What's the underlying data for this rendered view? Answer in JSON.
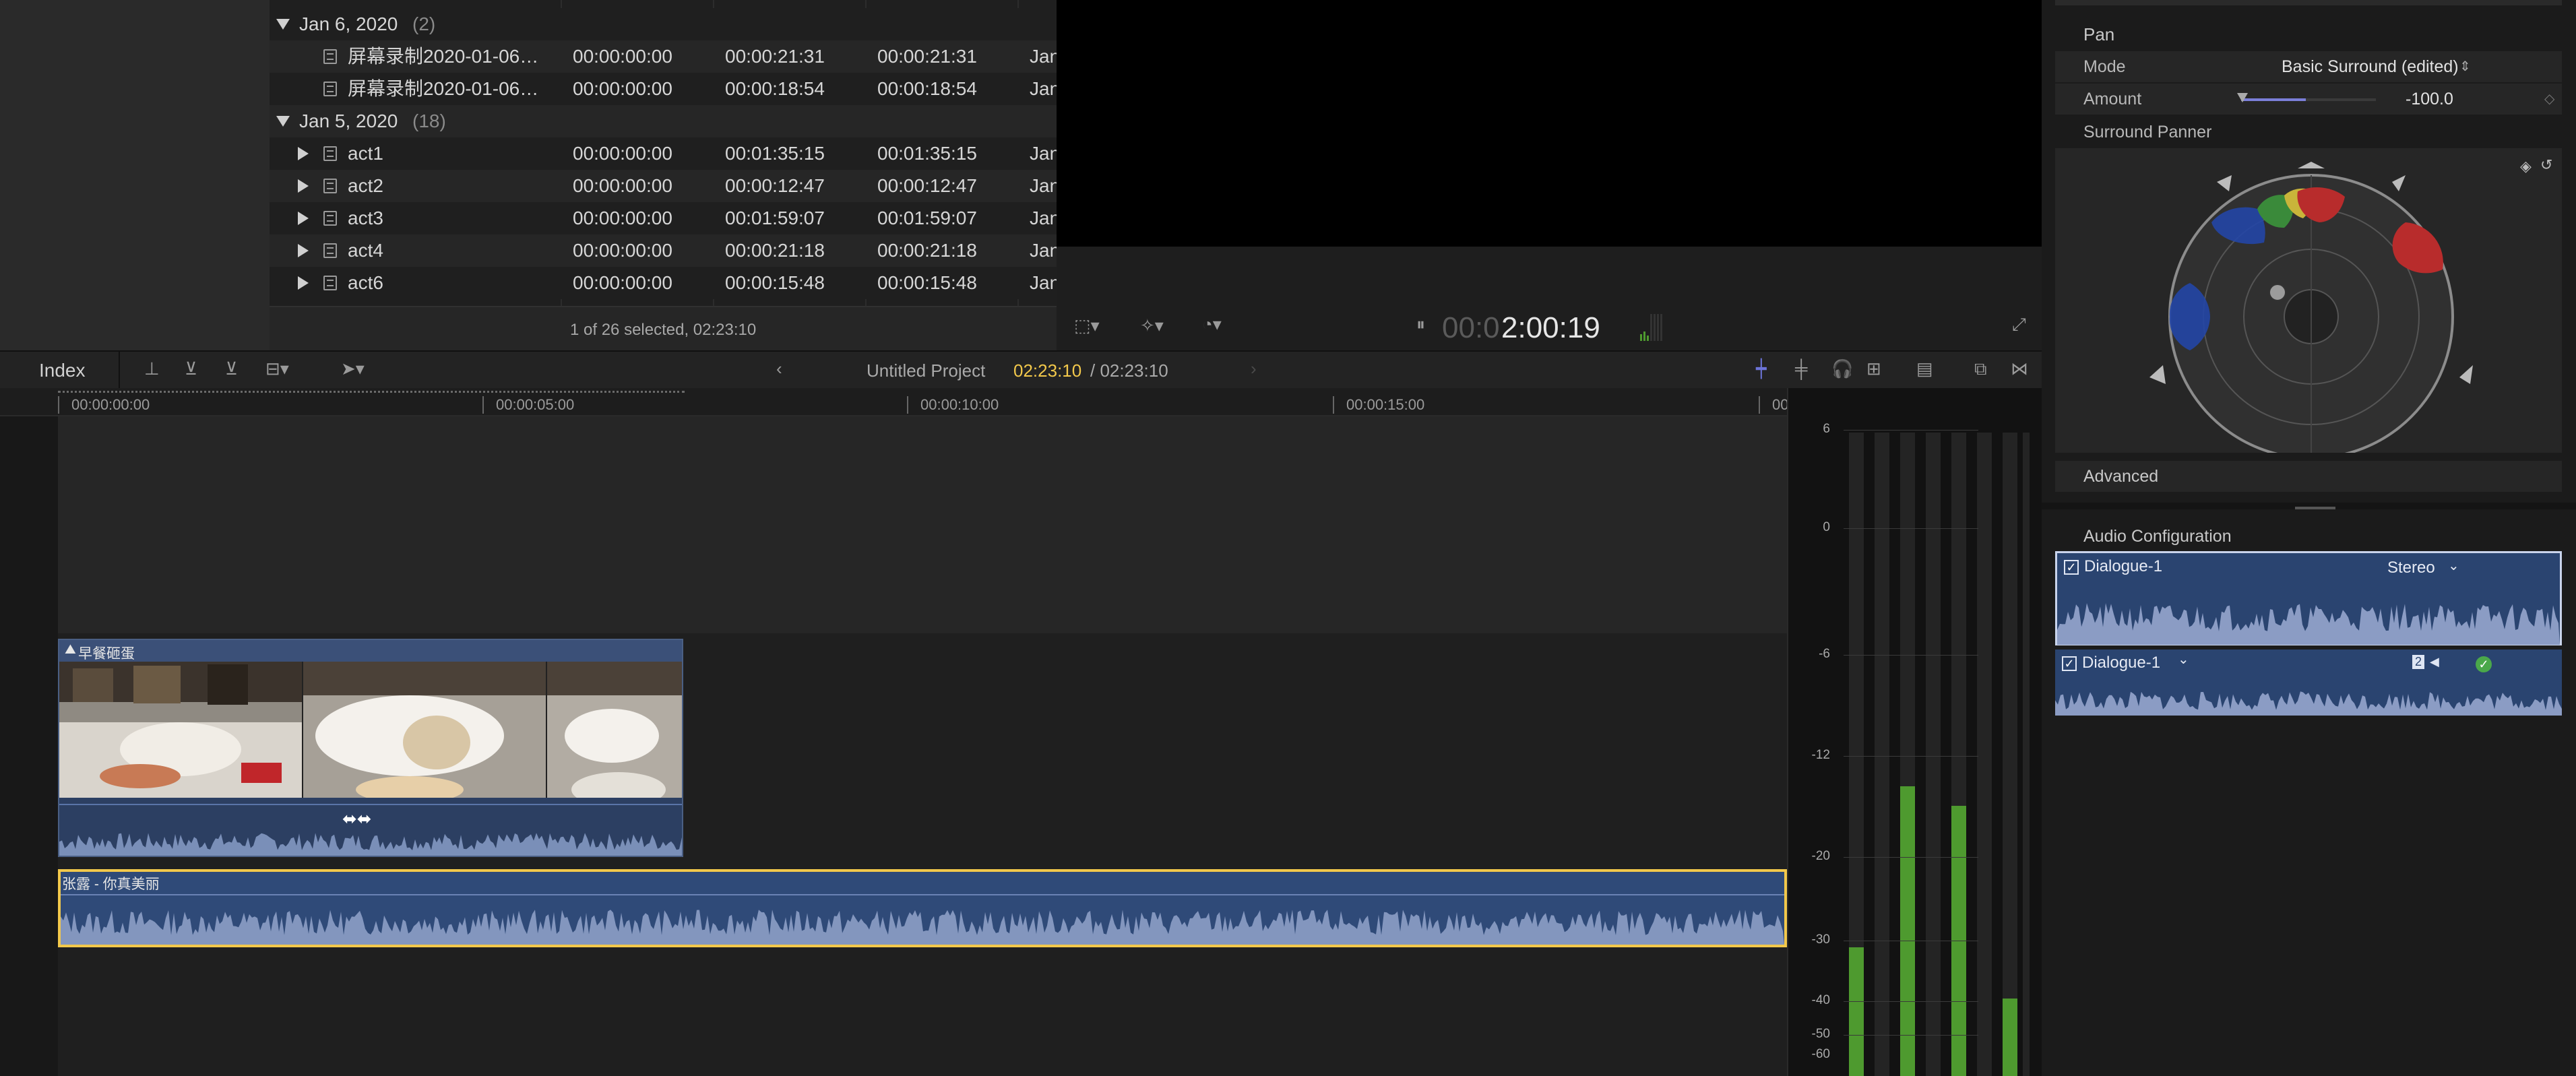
{
  "browser": {
    "groups": [
      {
        "date": "Jan 6, 2020",
        "count": "(2)"
      },
      {
        "date": "Jan 5, 2020",
        "count": "(18)"
      }
    ],
    "rows_jan6": [
      {
        "name": "屏幕录制2020-01-06…",
        "start": "00:00:00:00",
        "end": "00:00:21:31",
        "duration": "00:00:21:31",
        "date": "Jan"
      },
      {
        "name": "屏幕录制2020-01-06…",
        "start": "00:00:00:00",
        "end": "00:00:18:54",
        "duration": "00:00:18:54",
        "date": "Jan"
      }
    ],
    "rows_jan5": [
      {
        "name": "act1",
        "start": "00:00:00:00",
        "end": "00:01:35:15",
        "duration": "00:01:35:15",
        "date": "Jan"
      },
      {
        "name": "act2",
        "start": "00:00:00:00",
        "end": "00:00:12:47",
        "duration": "00:00:12:47",
        "date": "Jan"
      },
      {
        "name": "act3",
        "start": "00:00:00:00",
        "end": "00:01:59:07",
        "duration": "00:01:59:07",
        "date": "Jan"
      },
      {
        "name": "act4",
        "start": "00:00:00:00",
        "end": "00:00:21:18",
        "duration": "00:00:21:18",
        "date": "Jan"
      },
      {
        "name": "act6",
        "start": "00:00:00:00",
        "end": "00:00:15:48",
        "duration": "00:00:15:48",
        "date": "Jan"
      }
    ],
    "status": "1 of 26 selected, 02:23:10"
  },
  "viewer": {
    "timecode_dim": "00:0",
    "timecode_bright": "2:00:19"
  },
  "timeline": {
    "index_label": "Index",
    "project_name": "Untitled Project",
    "position": "02:23:10",
    "duration": "/ 02:23:10",
    "ruler": [
      "00:00:00:00",
      "00:00:05:00",
      "00:00:10:00",
      "00:00:15:00",
      "00"
    ],
    "video_clip_title": "早餐砸蛋",
    "audio_clip_title": "张露 - 你真美丽"
  },
  "meters": {
    "ticks": [
      "6",
      "0",
      "-6",
      "-12",
      "-20",
      "-30",
      "-40",
      "-50",
      "-60"
    ],
    "levels": [
      0.2,
      0.0,
      0.45,
      0.0,
      0.42,
      0.0,
      0.12,
      0.0
    ],
    "fill_color": "#4e9a2f"
  },
  "inspector": {
    "pan_title": "Pan",
    "mode_label": "Mode",
    "mode_value": "Basic Surround (edited)",
    "amount_label": "Amount",
    "amount_value": "-100.0",
    "panner_title": "Surround Panner",
    "advanced_label": "Advanced",
    "audio_config_title": "Audio Configuration",
    "components": [
      {
        "name": "Dialogue-1",
        "format": "Stereo"
      },
      {
        "name": "Dialogue-1",
        "format": "2"
      }
    ]
  },
  "colors": {
    "accent_yellow": "#f2c84b",
    "selection_blue": "#2f4a78",
    "meter_green": "#4e9a2f"
  }
}
